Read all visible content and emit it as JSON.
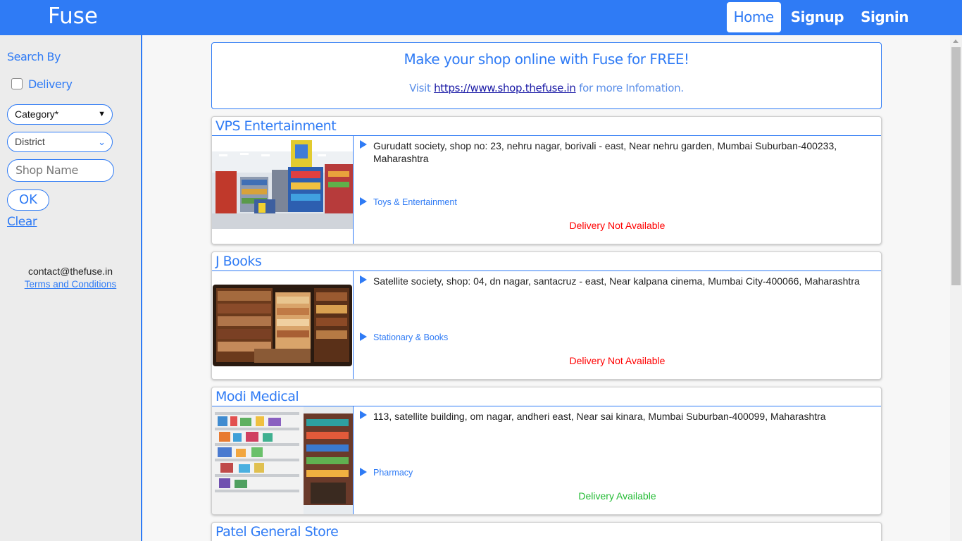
{
  "header": {
    "brand": "Fuse",
    "nav": [
      {
        "label": "Home",
        "active": true
      },
      {
        "label": "Signup",
        "active": false
      },
      {
        "label": "Signin",
        "active": false
      }
    ]
  },
  "sidebar": {
    "title": "Search By",
    "delivery_label": "Delivery",
    "delivery_checked": false,
    "category_value": "Category*",
    "district_value": "District",
    "shop_name_placeholder": "Shop Name",
    "ok_label": "OK",
    "clear_label": "Clear",
    "contact": "contact@thefuse.in",
    "terms": "Terms and Conditions"
  },
  "banner": {
    "title": "Make your shop online with Fuse for FREE!",
    "visit_prefix": "Visit",
    "link": "https://www.shop.thefuse.in",
    "visit_suffix": "for more Infomation."
  },
  "shops": [
    {
      "name": "VPS Entertainment",
      "address": "Gurudatt society, shop no: 23, nehru nagar, borivali - east, Near nehru garden, Mumbai Suburban-400233, Maharashtra",
      "category": "Toys & Entertainment",
      "delivery": "Delivery Not Available",
      "delivery_color": "#ff0000",
      "image": "toy-store-photo"
    },
    {
      "name": "J Books",
      "address": "Satellite society, shop: 04, dn nagar, santacruz - east, Near kalpana cinema, Mumbai City-400066, Maharashtra",
      "category": "Stationary & Books",
      "delivery": "Delivery Not Available",
      "delivery_color": "#ff0000",
      "image": "bookstore-photo"
    },
    {
      "name": "Modi Medical",
      "address": "113, satellite building, om nagar, andheri east, Near sai kinara, Mumbai Suburban-400099, Maharashtra",
      "category": "Pharmacy",
      "delivery": "Delivery Available",
      "delivery_color": "#22bb33",
      "image": "pharmacy-photo"
    },
    {
      "name": "Patel General Store"
    }
  ],
  "colors": {
    "accent": "#2f7bf5"
  }
}
